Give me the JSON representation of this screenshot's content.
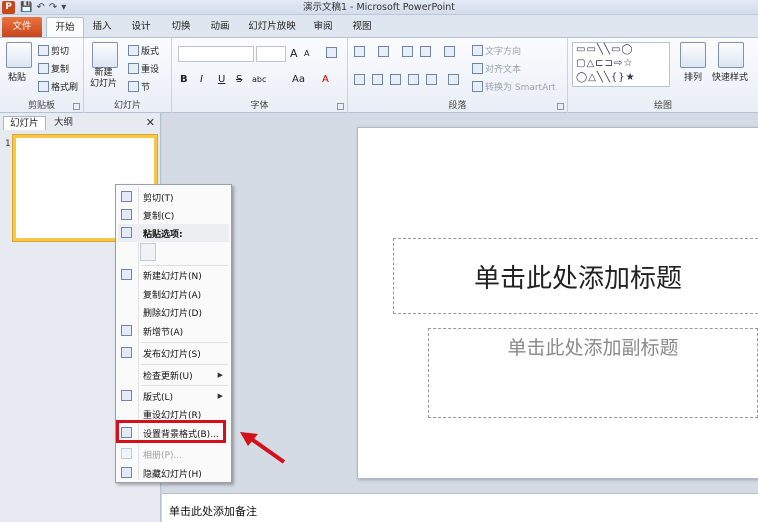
{
  "window": {
    "title": "演示文稿1 - Microsoft PowerPoint",
    "app_icon_letter": "P",
    "qat": [
      "💾",
      "↶",
      "↷",
      "▾"
    ]
  },
  "tabs": [
    "文件",
    "开始",
    "插入",
    "设计",
    "切换",
    "动画",
    "幻灯片放映",
    "审阅",
    "视图"
  ],
  "ribbon": {
    "clipboard": {
      "label": "剪贴板",
      "paste": "粘贴",
      "cut": "剪切",
      "copy": "复制",
      "format_painter": "格式刷"
    },
    "slides": {
      "label": "幻灯片",
      "new_slide": "新建\n幻灯片",
      "layout": "版式",
      "reset": "重设",
      "section": "节"
    },
    "font": {
      "label": "字体",
      "grow": "A",
      "shrink": "A",
      "bold": "B",
      "italic": "I",
      "underline": "U",
      "strike": "S",
      "shadow_spacing": "abc",
      "case": "Aa",
      "color": "A"
    },
    "paragraph": {
      "label": "段落",
      "text_direction": "文字方向",
      "align_text": "对齐文本",
      "smartart": "转换为 SmartArt"
    },
    "drawing": {
      "label": "绘图",
      "arrange": "排列",
      "quick_styles": "快速样式",
      "shapes": "▭▭╲╲▭◯\n▢△⊏⊐⇨☆\n◯△╲╲{}★"
    }
  },
  "left_pane": {
    "tab_slides": "幻灯片",
    "tab_outline": "大纲",
    "close": "✕",
    "slide_number": "1"
  },
  "slide": {
    "title_placeholder": "单击此处添加标题",
    "subtitle_placeholder": "单击此处添加副标题"
  },
  "notes_placeholder": "单击此处添加备注",
  "context_menu": {
    "items": [
      {
        "label": "剪切(T)",
        "icon": "scissors-icon",
        "enabled": true
      },
      {
        "label": "复制(C)",
        "icon": "copy-icon",
        "enabled": true
      },
      {
        "label": "粘贴选项:",
        "icon": "paste-icon",
        "enabled": true
      },
      {
        "label": "新建幻灯片(N)",
        "icon": "new-slide-icon",
        "enabled": true
      },
      {
        "label": "复制幻灯片(A)",
        "icon": "",
        "enabled": true
      },
      {
        "label": "删除幻灯片(D)",
        "icon": "",
        "enabled": true
      },
      {
        "label": "新增节(A)",
        "icon": "section-icon",
        "enabled": true
      },
      {
        "label": "发布幻灯片(S)",
        "icon": "publish-icon",
        "enabled": true
      },
      {
        "label": "检查更新(U)",
        "icon": "",
        "enabled": true,
        "submenu": true
      },
      {
        "label": "版式(L)",
        "icon": "layout-icon",
        "enabled": true,
        "submenu": true
      },
      {
        "label": "重设幻灯片(R)",
        "icon": "",
        "enabled": true
      },
      {
        "label": "设置背景格式(B)...",
        "icon": "background-icon",
        "enabled": true
      },
      {
        "label": "相册(P)...",
        "icon": "album-icon",
        "enabled": false
      },
      {
        "label": "隐藏幻灯片(H)",
        "icon": "hide-slide-icon",
        "enabled": true
      }
    ],
    "submenu_arrow": "▶"
  },
  "colors": {
    "file_tab": "#c8461c",
    "highlight_box": "#d4101a",
    "selected_thumb": "#f5c84c"
  }
}
